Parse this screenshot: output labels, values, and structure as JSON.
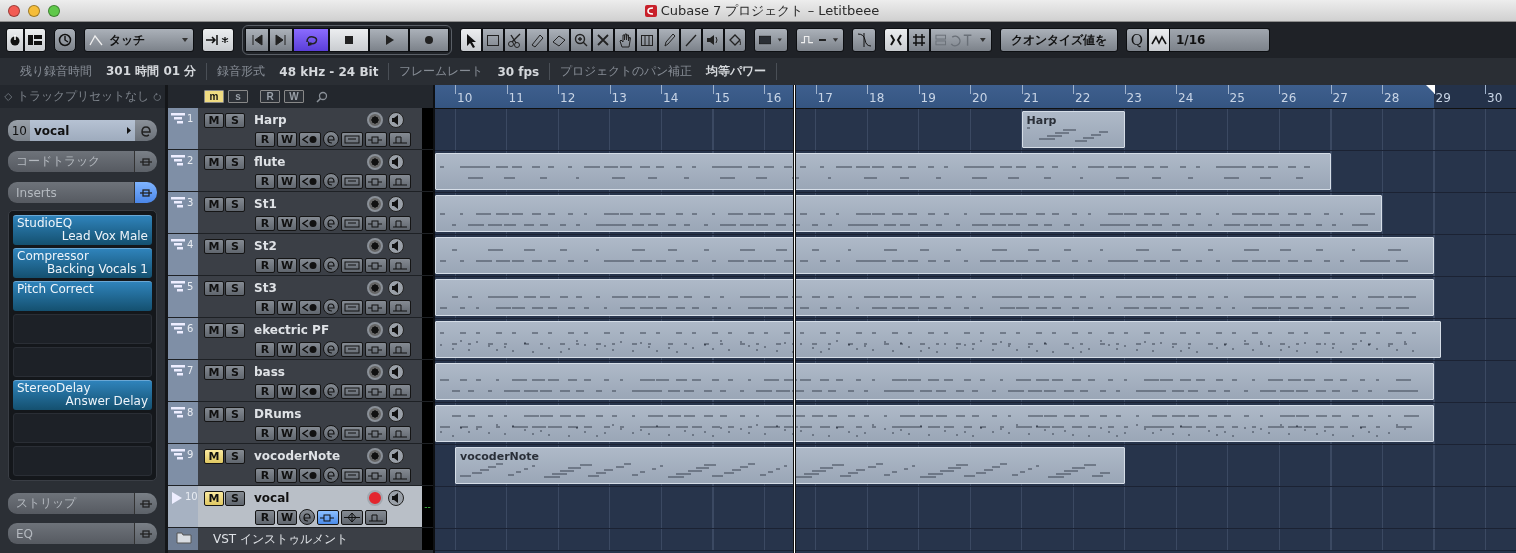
{
  "window": {
    "title": "Cubase 7 プロジェクト – Letitbeee"
  },
  "toolbar": {
    "automation_mode": "タッチ",
    "transport": [
      {
        "kind": "prev",
        "on": false
      },
      {
        "kind": "next",
        "on": false
      },
      {
        "kind": "cycle",
        "on": true
      },
      {
        "kind": "stop",
        "on": true
      },
      {
        "kind": "play",
        "on": false
      },
      {
        "kind": "record",
        "on": false
      }
    ],
    "tools": [
      {
        "kind": "select",
        "selected": true
      },
      {
        "kind": "range",
        "selected": false
      },
      {
        "kind": "split",
        "selected": false
      },
      {
        "kind": "glue",
        "selected": false
      },
      {
        "kind": "erase",
        "selected": false
      },
      {
        "kind": "zoom",
        "selected": false
      },
      {
        "kind": "mute",
        "selected": false
      },
      {
        "kind": "hand",
        "selected": false
      },
      {
        "kind": "comp",
        "selected": false
      },
      {
        "kind": "draw",
        "selected": false
      },
      {
        "kind": "line",
        "selected": false
      },
      {
        "kind": "play",
        "selected": false
      },
      {
        "kind": "color",
        "selected": false
      }
    ],
    "snap_zero": true,
    "quantize_preset": "クオンタイズ値を",
    "quantize_label": "Q",
    "quantize_value": "1/16"
  },
  "info": [
    {
      "label": "残り録音時間",
      "value": "301 時間 01 分"
    },
    {
      "label": "録音形式",
      "value": "48 kHz - 24 Bit"
    },
    {
      "label": "フレームレート",
      "value": "30 fps"
    },
    {
      "label": "プロジェクトのパン補正",
      "value": "均等パワー"
    }
  ],
  "inspector": {
    "preset": "トラックプリセットなし",
    "track_number": "10",
    "track_name": "vocal",
    "sections": [
      {
        "label": "コードトラック",
        "expanded": false
      },
      {
        "label": "Inserts",
        "expanded": true
      }
    ],
    "inserts": [
      {
        "kind": "plugin",
        "name": "StudioEQ",
        "preset": "Lead Vox Male"
      },
      {
        "kind": "plugin",
        "name": "Compressor",
        "preset": "Backing Vocals 1"
      },
      {
        "kind": "plugin",
        "name": "Pitch Correct"
      },
      {
        "kind": "empty"
      },
      {
        "kind": "empty"
      },
      {
        "kind": "plugin",
        "name": "StereoDelay",
        "preset": "Answer Delay"
      },
      {
        "kind": "empty"
      },
      {
        "kind": "empty"
      }
    ],
    "bottom_sections": [
      {
        "label": "ストリップ",
        "expanded": false
      },
      {
        "label": "EQ",
        "expanded": false
      }
    ]
  },
  "track_filters": [
    {
      "label": "m",
      "on": true
    },
    {
      "label": "s",
      "on": false
    },
    {
      "label": "R",
      "on": false
    },
    {
      "label": "W",
      "on": false
    }
  ],
  "ruler": {
    "bars": [
      "10",
      "11",
      "12",
      "13",
      "14",
      "15",
      "16",
      "17",
      "18",
      "19",
      "20",
      "21",
      "22",
      "23",
      "24",
      "25",
      "26",
      "27",
      "28",
      "29",
      "30"
    ]
  },
  "tracks": [
    {
      "number": "1",
      "name": "Harp",
      "kind": "instrument",
      "mute_label": "M",
      "solo_label": "S",
      "read_label": "R",
      "write_label": "W",
      "muted": false,
      "record_armed": false,
      "selected": false,
      "part_label": "Harp"
    },
    {
      "number": "2",
      "name": "flute",
      "kind": "instrument",
      "mute_label": "M",
      "solo_label": "S",
      "read_label": "R",
      "write_label": "W",
      "muted": false,
      "record_armed": false,
      "selected": false
    },
    {
      "number": "3",
      "name": "St1",
      "kind": "instrument",
      "mute_label": "M",
      "solo_label": "S",
      "read_label": "R",
      "write_label": "W",
      "muted": false,
      "record_armed": false,
      "selected": false
    },
    {
      "number": "4",
      "name": "St2",
      "kind": "instrument",
      "mute_label": "M",
      "solo_label": "S",
      "read_label": "R",
      "write_label": "W",
      "muted": false,
      "record_armed": false,
      "selected": false
    },
    {
      "number": "5",
      "name": "St3",
      "kind": "instrument",
      "mute_label": "M",
      "solo_label": "S",
      "read_label": "R",
      "write_label": "W",
      "muted": false,
      "record_armed": false,
      "selected": false
    },
    {
      "number": "6",
      "name": "ekectric PF",
      "kind": "instrument",
      "mute_label": "M",
      "solo_label": "S",
      "read_label": "R",
      "write_label": "W",
      "muted": false,
      "record_armed": false,
      "selected": false
    },
    {
      "number": "7",
      "name": "bass",
      "kind": "instrument",
      "mute_label": "M",
      "solo_label": "S",
      "read_label": "R",
      "write_label": "W",
      "muted": false,
      "record_armed": false,
      "selected": false
    },
    {
      "number": "8",
      "name": "DRums",
      "kind": "instrument",
      "mute_label": "M",
      "solo_label": "S",
      "read_label": "R",
      "write_label": "W",
      "muted": false,
      "record_armed": false,
      "selected": false
    },
    {
      "number": "9",
      "name": "vocoderNote",
      "kind": "instrument",
      "mute_label": "M",
      "solo_label": "S",
      "read_label": "R",
      "write_label": "W",
      "muted": true,
      "record_armed": false,
      "selected": false,
      "part_label": "vocoderNote"
    },
    {
      "number": "10",
      "name": "vocal",
      "kind": "audio",
      "mute_label": "M",
      "solo_label": "S",
      "read_label": "R",
      "write_label": "W",
      "muted": true,
      "record_armed": true,
      "selected": true,
      "meter_text": "--"
    }
  ],
  "folder_track": {
    "name": "VST インストゥルメント"
  }
}
